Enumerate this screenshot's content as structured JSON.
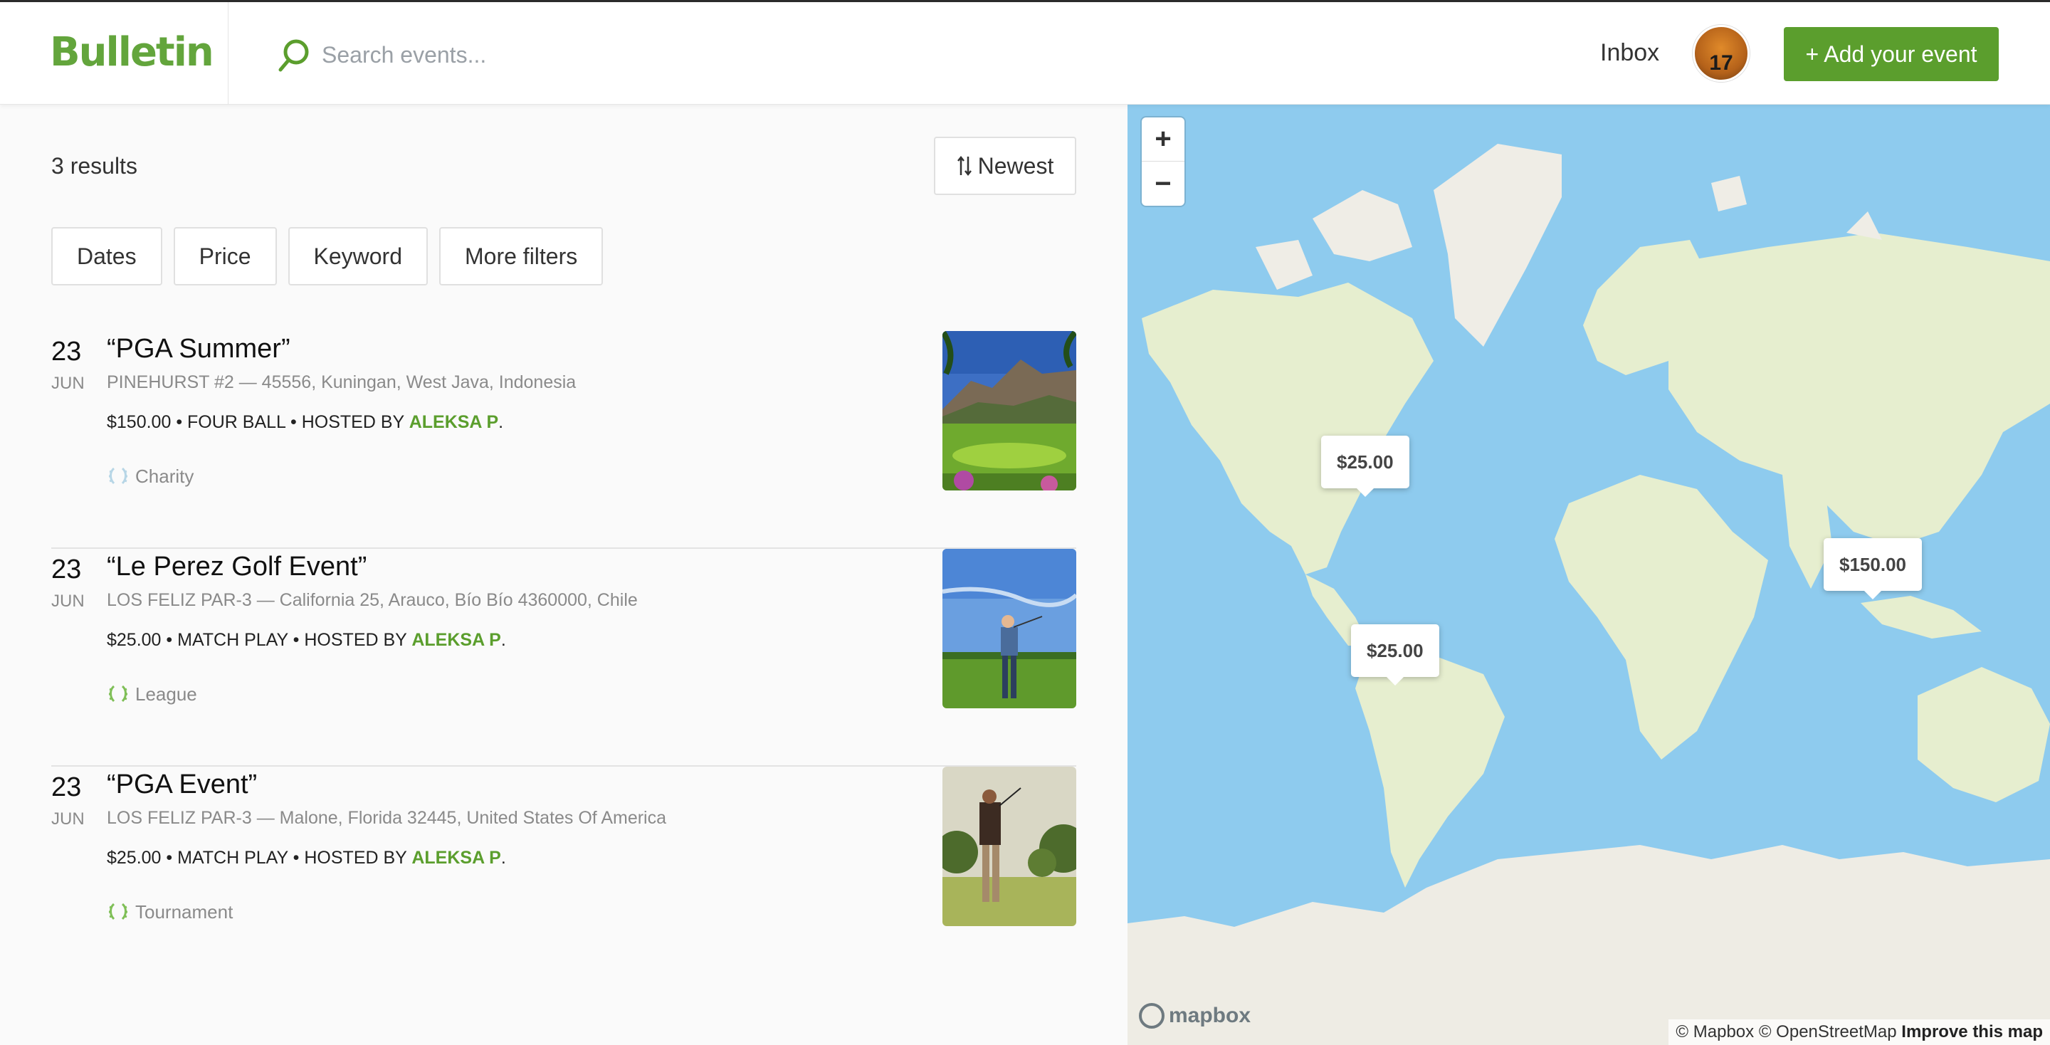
{
  "header": {
    "logo": "Bulletin",
    "search_placeholder": "Search events...",
    "inbox": "Inbox",
    "avatar_text": "17",
    "add_button": "+ Add your event"
  },
  "results": {
    "count_label": "3 results",
    "sort_label": "Newest",
    "filters": [
      "Dates",
      "Price",
      "Keyword",
      "More filters"
    ]
  },
  "events": [
    {
      "day": "23",
      "month": "JUN",
      "title": "“PGA Summer”",
      "venue": "PINEHURST #2",
      "address": "45556, Kuningan, West Java, Indonesia",
      "price": "$150.00",
      "format": "FOUR BALL",
      "hosted_by": "HOSTED BY",
      "host": "ALEKSA P",
      "category": "Charity",
      "image": "golf course with mountains"
    },
    {
      "day": "23",
      "month": "JUN",
      "title": "“Le Perez Golf Event”",
      "venue": "LOS FELIZ PAR-3",
      "address": "California 25, Arauco, Bío Bío 4360000, Chile",
      "price": "$25.00",
      "format": "MATCH PLAY",
      "hosted_by": "HOSTED BY",
      "host": "ALEKSA P",
      "category": "League",
      "image": "golfer swinging on fairway"
    },
    {
      "day": "23",
      "month": "JUN",
      "title": "“PGA Event”",
      "venue": "LOS FELIZ PAR-3",
      "address": "Malone, Florida 32445, United States Of America",
      "price": "$25.00",
      "format": "MATCH PLAY",
      "hosted_by": "HOSTED BY",
      "host": "ALEKSA P",
      "category": "Tournament",
      "image": "golfer finishing swing"
    }
  ],
  "map": {
    "zoom_in": "+",
    "zoom_out": "−",
    "pins": [
      "$25.00",
      "$150.00",
      "$25.00"
    ],
    "logo": "mapbox",
    "attribution": "© Mapbox © OpenStreetMap",
    "improve": "Improve this map"
  },
  "colors": {
    "brand_green": "#5b9e2d",
    "logo_green": "#63a53c",
    "ocean": "#8ecbee",
    "land": "#e6eecf"
  }
}
